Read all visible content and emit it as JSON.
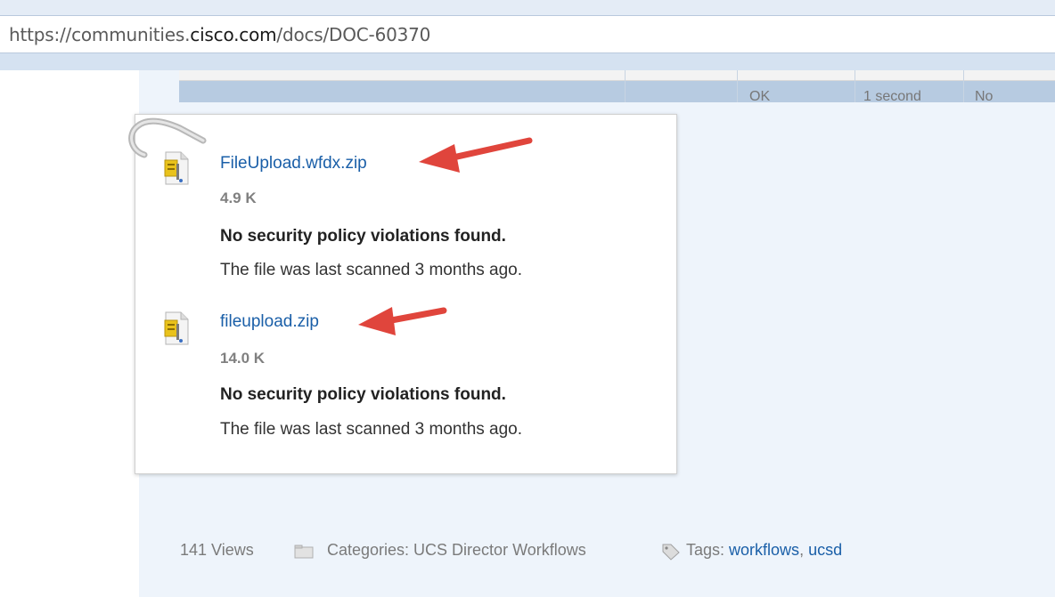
{
  "browser": {
    "url_prefix": "https://communities.",
    "url_domain": "cisco.com",
    "url_path": "/docs/DOC-60370"
  },
  "table_remnant": {
    "cells": [
      "OK",
      "1 second",
      "No"
    ]
  },
  "attachments": [
    {
      "name": "FileUpload.wfdx.zip",
      "size": "4.9 K",
      "status": "No security policy violations found.",
      "scan": "The file was last scanned 3 months ago."
    },
    {
      "name": "fileupload.zip",
      "size": "14.0 K",
      "status": "No security policy violations found.",
      "scan": "The file was last scanned 3 months ago."
    }
  ],
  "meta": {
    "views": "141 Views",
    "categories": "Categories: UCS Director Workflows",
    "tags_label": "Tags:",
    "tags": [
      "workflows",
      "ucsd"
    ],
    "tag_separator": ","
  },
  "colors": {
    "link": "#1a5fa8",
    "arrow": "#e0453c",
    "page_bg": "#eef4fb"
  },
  "icons": [
    "paperclip-icon",
    "zip-file-icon",
    "folder-icon",
    "tag-icon",
    "arrow-annotation-icon"
  ]
}
